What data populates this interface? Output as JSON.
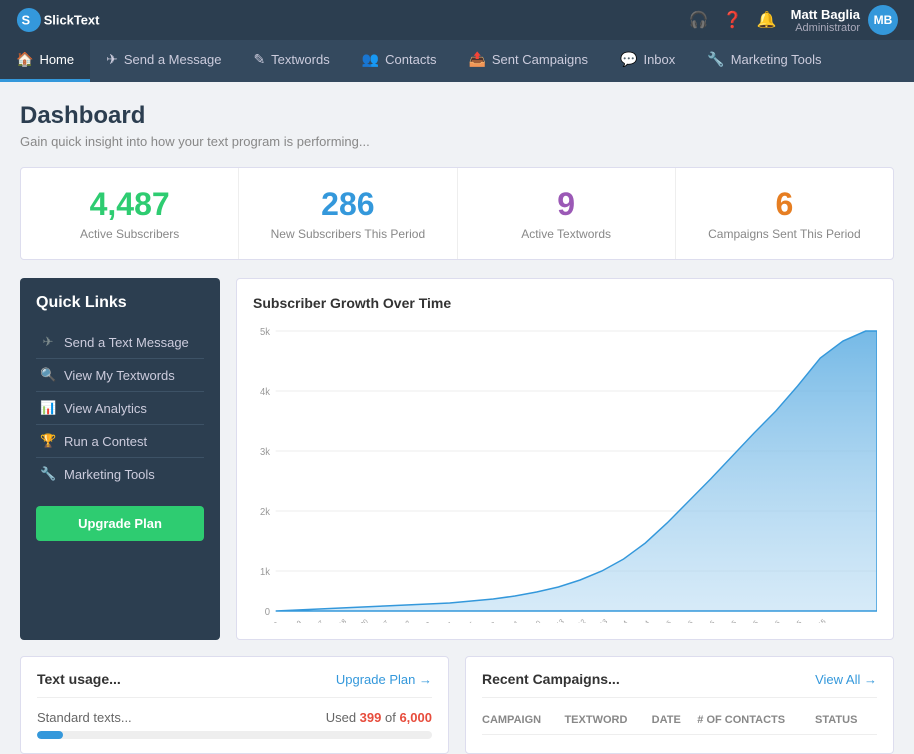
{
  "topbar": {
    "logo_text": "SlickText",
    "user": {
      "name": "Matt Baglia",
      "role": "Administrator",
      "initials": "MB"
    },
    "icons": [
      "headset-icon",
      "help-icon",
      "bell-icon"
    ]
  },
  "navbar": {
    "items": [
      {
        "id": "home",
        "label": "Home",
        "icon": "🏠",
        "active": true
      },
      {
        "id": "send-message",
        "label": "Send a Message",
        "icon": "✈"
      },
      {
        "id": "textwords",
        "label": "Textwords",
        "icon": "✎"
      },
      {
        "id": "contacts",
        "label": "Contacts",
        "icon": "👥"
      },
      {
        "id": "sent-campaigns",
        "label": "Sent Campaigns",
        "icon": "📤"
      },
      {
        "id": "inbox",
        "label": "Inbox",
        "icon": "💬"
      },
      {
        "id": "marketing-tools",
        "label": "Marketing Tools",
        "icon": "🔧"
      }
    ]
  },
  "page": {
    "title": "Dashboard",
    "subtitle": "Gain quick insight into how your text program is performing..."
  },
  "stats": [
    {
      "id": "active-subscribers",
      "value": "4,487",
      "label": "Active Subscribers",
      "color_class": "stat-green"
    },
    {
      "id": "new-subscribers",
      "value": "286",
      "label": "New Subscribers This Period",
      "color_class": "stat-blue"
    },
    {
      "id": "active-textwords",
      "value": "9",
      "label": "Active Textwords",
      "color_class": "stat-purple"
    },
    {
      "id": "campaigns-sent",
      "value": "6",
      "label": "Campaigns Sent This Period",
      "color_class": "stat-orange"
    }
  ],
  "quick_links": {
    "title": "Quick Links",
    "items": [
      {
        "id": "send-text",
        "label": "Send a Text Message",
        "icon": "✈"
      },
      {
        "id": "view-textwords",
        "label": "View My Textwords",
        "icon": "🔍"
      },
      {
        "id": "view-analytics",
        "label": "View Analytics",
        "icon": "📊"
      },
      {
        "id": "run-contest",
        "label": "Run a Contest",
        "icon": "🏆"
      },
      {
        "id": "marketing-tools",
        "label": "Marketing Tools",
        "icon": "🔧"
      }
    ],
    "upgrade_label": "Upgrade Plan"
  },
  "chart": {
    "title": "Subscriber Growth Over Time",
    "y_labels": [
      "5k",
      "4k",
      "3k",
      "2k",
      "1k",
      "0"
    ],
    "x_labels": [
      "7/8",
      "8/19",
      "9/17",
      "10/18",
      "11/20",
      "1/27",
      "2/22",
      "4/2",
      "5/4",
      "6/5",
      "7/8",
      "8/11",
      "9/10",
      "10/13",
      "11/12",
      "12/13",
      "1/14",
      "2/14",
      "3/16",
      "4/16",
      "5/16",
      "6/15",
      "7/15",
      "8/16",
      "9/15",
      "10/15"
    ]
  },
  "text_usage": {
    "title": "Text usage...",
    "upgrade_label": "Upgrade Plan →",
    "rows": [
      {
        "label": "Standard texts...",
        "used": "399",
        "total": "6,000",
        "percent": 6.65
      }
    ]
  },
  "recent_campaigns": {
    "title": "Recent Campaigns...",
    "view_all_label": "View All →",
    "columns": [
      "CAMPAIGN",
      "TEXTWORD",
      "DATE",
      "# OF CONTACTS",
      "STATUS"
    ]
  }
}
